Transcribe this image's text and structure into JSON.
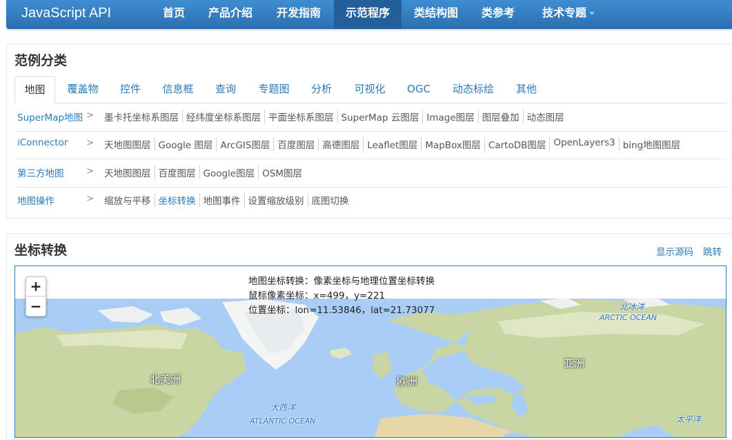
{
  "navbar": {
    "brand": "JavaScript API",
    "items": [
      {
        "label": "首页"
      },
      {
        "label": "产品介绍"
      },
      {
        "label": "开发指南"
      },
      {
        "label": "示范程序",
        "active": true
      },
      {
        "label": "类结构图"
      },
      {
        "label": "类参考"
      },
      {
        "label": "技术专题",
        "dropdown": true
      }
    ]
  },
  "category_panel": {
    "title": "范例分类",
    "tabs": [
      "地图",
      "覆盖物",
      "控件",
      "信息框",
      "查询",
      "专题图",
      "分析",
      "可视化",
      "OGC",
      "动态标绘",
      "其他"
    ],
    "active_tab": "地图",
    "rows": [
      {
        "label": "SuperMap地图",
        "arrow": ">",
        "links": [
          "墨卡托坐标系图层",
          "经纬度坐标系图层",
          "平面坐标系图层",
          "SuperMap 云图层",
          "Image图层",
          "图层叠加",
          "动态图层"
        ]
      },
      {
        "label": "iConnector",
        "arrow": ">",
        "links": [
          "天地图图层",
          "Google 图层",
          "ArcGIS图层",
          "百度图层",
          "高德图层",
          "Leaflet图层",
          "MapBox图层",
          "CartoDB图层",
          "OpenLayers3",
          "bing地图图层"
        ]
      },
      {
        "label": "第三方地图",
        "arrow": ">",
        "links": [
          "天地图图层",
          "百度图层",
          "Google图层",
          "OSM图层"
        ]
      },
      {
        "label": "地图操作",
        "arrow": ">",
        "links": [
          "缩放与平移",
          "坐标转换",
          "地图事件",
          "设置缩放级别",
          "底图切换"
        ],
        "current": "坐标转换"
      }
    ]
  },
  "example_panel": {
    "title": "坐标转换",
    "show_source": "显示源码",
    "jump": "跳转"
  },
  "map": {
    "zoom_in": "+",
    "zoom_out": "−",
    "info_title": "地图坐标转换：像素坐标与地理位置坐标转换",
    "info_pixel": "鼠标像素坐标：x=499，y=221",
    "info_geo": "位置坐标：lon=11.53846，lat=21.73077",
    "labels": {
      "north_america": "北美洲",
      "europe": "欧洲",
      "asia": "亚洲",
      "atlantic_cn": "大西洋",
      "atlantic_en": "ATLANTIC OCEAN",
      "arctic_cn": "北冰洋",
      "arctic_en": "ARCTIC OCEAN",
      "pacific_cn": "太平洋"
    },
    "colors": {
      "ocean": "#a9cdf5",
      "land": "#c9d6a3",
      "snow": "#f3f5f5",
      "desert": "#e6d7a8"
    }
  }
}
